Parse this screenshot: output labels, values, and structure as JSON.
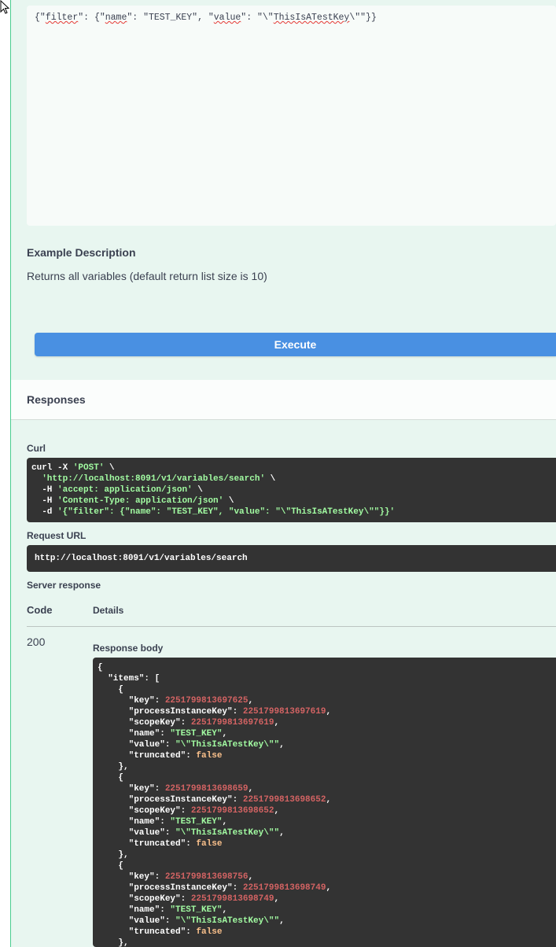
{
  "request_body": {
    "segments": [
      {
        "text": "{\"",
        "sq": false
      },
      {
        "text": "filter",
        "sq": true
      },
      {
        "text": "\": {\"",
        "sq": false
      },
      {
        "text": "name",
        "sq": true
      },
      {
        "text": "\": \"TEST_KEY\", \"",
        "sq": false
      },
      {
        "text": "value",
        "sq": true
      },
      {
        "text": "\": \"\\\"",
        "sq": false
      },
      {
        "text": "ThisIsATestKey",
        "sq": true
      },
      {
        "text": "\\\"\"}}",
        "sq": false
      }
    ]
  },
  "example": {
    "title": "Example Description",
    "description": "Returns all variables (default return list size is 10)"
  },
  "execute_label": "Execute",
  "responses": {
    "title": "Responses",
    "curl_label": "Curl",
    "curl_lines": [
      [
        {
          "t": "curl -X ",
          "c": "w"
        },
        {
          "t": "'POST'",
          "c": "s"
        },
        {
          "t": " \\",
          "c": "w"
        }
      ],
      [
        {
          "t": "  ",
          "c": "w"
        },
        {
          "t": "'http://localhost:8091/v1/variables/search'",
          "c": "s"
        },
        {
          "t": " \\",
          "c": "w"
        }
      ],
      [
        {
          "t": "  -H ",
          "c": "w"
        },
        {
          "t": "'accept: application/json'",
          "c": "s"
        },
        {
          "t": " \\",
          "c": "w"
        }
      ],
      [
        {
          "t": "  -H ",
          "c": "w"
        },
        {
          "t": "'Content-Type: application/json'",
          "c": "s"
        },
        {
          "t": " \\",
          "c": "w"
        }
      ],
      [
        {
          "t": "  -d ",
          "c": "w"
        },
        {
          "t": "'{\"filter\": {\"name\": \"TEST_KEY\", \"value\": \"\\\"ThisIsATestKey\\\"\"}}'",
          "c": "s"
        }
      ]
    ],
    "request_url_label": "Request URL",
    "request_url": "http://localhost:8091/v1/variables/search",
    "server_response_label": "Server response",
    "col_code": "Code",
    "col_details": "Details",
    "status_code": "200",
    "response_body_label": "Response body",
    "items": [
      {
        "key": "2251799813697625",
        "processInstanceKey": "2251799813697619",
        "scopeKey": "2251799813697619",
        "name": "TEST_KEY",
        "value": "\\\"ThisIsATestKey\\\"",
        "truncated": "false"
      },
      {
        "key": "2251799813698659",
        "processInstanceKey": "2251799813698652",
        "scopeKey": "2251799813698652",
        "name": "TEST_KEY",
        "value": "\\\"ThisIsATestKey\\\"",
        "truncated": "false"
      },
      {
        "key": "2251799813698756",
        "processInstanceKey": "2251799813698749",
        "scopeKey": "2251799813698749",
        "name": "TEST_KEY",
        "value": "\\\"ThisIsATestKey\\\"",
        "truncated": "false"
      }
    ]
  }
}
